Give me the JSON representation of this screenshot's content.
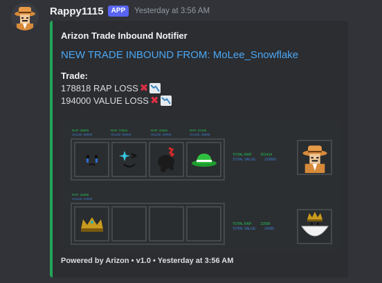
{
  "message": {
    "username": "Rappy1115",
    "badge": "APP",
    "timestamp": "Yesterday at 3:56 AM"
  },
  "embed": {
    "accent_color": "#23a559",
    "author": "Arizon Trade Inbound Notifier",
    "title": "NEW TRADE INBOUND FROM: MoLee_Snowflake",
    "field_name": "Trade:",
    "rap_line": "178818 RAP LOSS",
    "value_line": "194000 VALUE LOSS",
    "footer": "Powered by Arizon • v1.0 • Yesterday at 3:56 AM"
  },
  "trade_image": {
    "offer_items": [
      {
        "rap": "RAP: 49900",
        "value": "VALUE: 60000",
        "icon": "tears-face-icon"
      },
      {
        "rap": "RAP: 73534",
        "value": "VALUE: 80000",
        "icon": "sparkle-smile-face-icon"
      },
      {
        "rap": "RAP: 41664",
        "value": "VALUE: 40000",
        "icon": "black-hair-red-horn-icon"
      },
      {
        "rap": "RAP: 37425",
        "value": "VALUE: 38000",
        "icon": "green-fedora-icon"
      }
    ],
    "offer_totals": {
      "rap_label": "TOTAL RAP:",
      "rap_value": "201414",
      "value_label": "TOTAL VALUE:",
      "value_value": "218000"
    },
    "request_items": [
      {
        "rap": "RAP: 22596",
        "value": "VALUE: 24000",
        "icon": "gold-crown-icon"
      }
    ],
    "request_totals": {
      "rap_label": "TOTAL RAP:",
      "rap_value": "22596",
      "value_label": "TOTAL VALUE:",
      "value_value": "24000"
    },
    "colors": {
      "rap": "#22c45a",
      "value": "#3d7fd6"
    }
  }
}
